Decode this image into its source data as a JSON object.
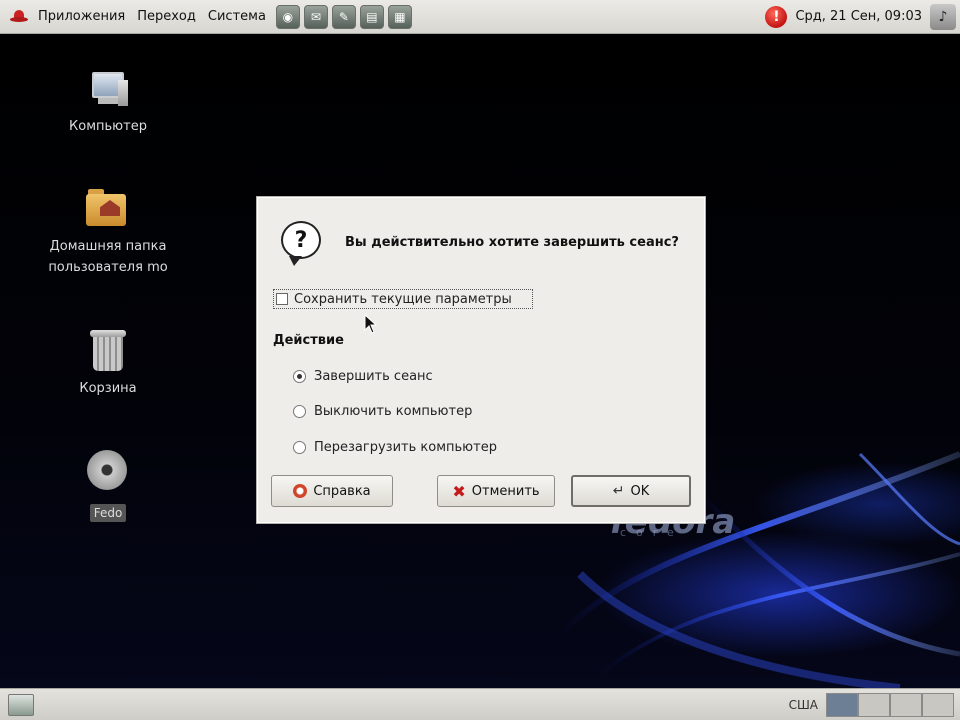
{
  "top_panel": {
    "menus": [
      "Приложения",
      "Переход",
      "Система"
    ],
    "clock": "Срд, 21 Сен, 09:03",
    "launchers": [
      "web-browser-icon",
      "mail-icon",
      "writer-icon",
      "presentation-icon",
      "spreadsheet-icon"
    ]
  },
  "desktop": {
    "icons": [
      {
        "label": "Компьютер",
        "icon": "computer-icon"
      },
      {
        "label": "Домашняя папка\nпользователя mo",
        "icon": "home-folder-icon"
      },
      {
        "label": "Корзина",
        "icon": "trash-icon"
      },
      {
        "label": "Fedo",
        "icon": "disc-icon"
      }
    ],
    "brand": "fedora",
    "brand_sub": "core"
  },
  "dialog": {
    "question": "Вы действительно хотите завершить сеанс?",
    "save_settings_label": "Сохранить текущие параметры",
    "save_settings_checked": false,
    "action_heading": "Действие",
    "options": [
      {
        "label": "Завершить сеанс",
        "checked": true
      },
      {
        "label": "Выключить компьютер",
        "checked": false
      },
      {
        "label": "Перезагрузить компьютер",
        "checked": false
      }
    ],
    "buttons": {
      "help": "Справка",
      "cancel": "Отменить",
      "ok": "OK"
    }
  },
  "bottom_panel": {
    "keyboard_layout": "США"
  },
  "colors": {
    "panel": "#dad8d2",
    "dialog_bg": "#efedea",
    "accent_red": "#c92222"
  }
}
